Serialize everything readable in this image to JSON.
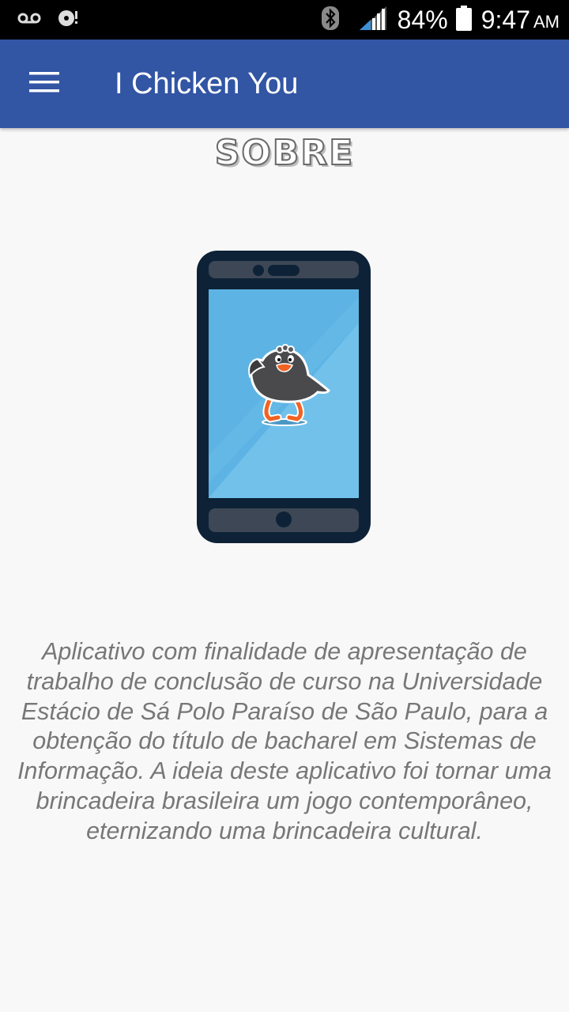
{
  "status_bar": {
    "left_icons": [
      "voicemail-icon",
      "sync-disc-icon"
    ],
    "right_icons": [
      "bluetooth-icon",
      "signal-icon",
      "battery-icon"
    ],
    "battery": "84%",
    "time": "9:47",
    "ampm": "AM"
  },
  "app_bar": {
    "menu_icon": "menu-icon",
    "title": "I Chicken You",
    "color": "#3255a4"
  },
  "content": {
    "heading": "SOBRE",
    "illustration": "phone-with-chicken-illustration",
    "description": "Aplicativo com finalidade de apresentação de trabalho de conclusão de curso na Universidade Estácio de Sá Polo Paraíso de São Paulo, para a obtenção do título de bacharel em Sistemas de Informação. A ideia deste aplicativo foi tornar uma brincadeira brasileira um jogo contemporâneo, eternizando uma brincadeira cultural."
  }
}
